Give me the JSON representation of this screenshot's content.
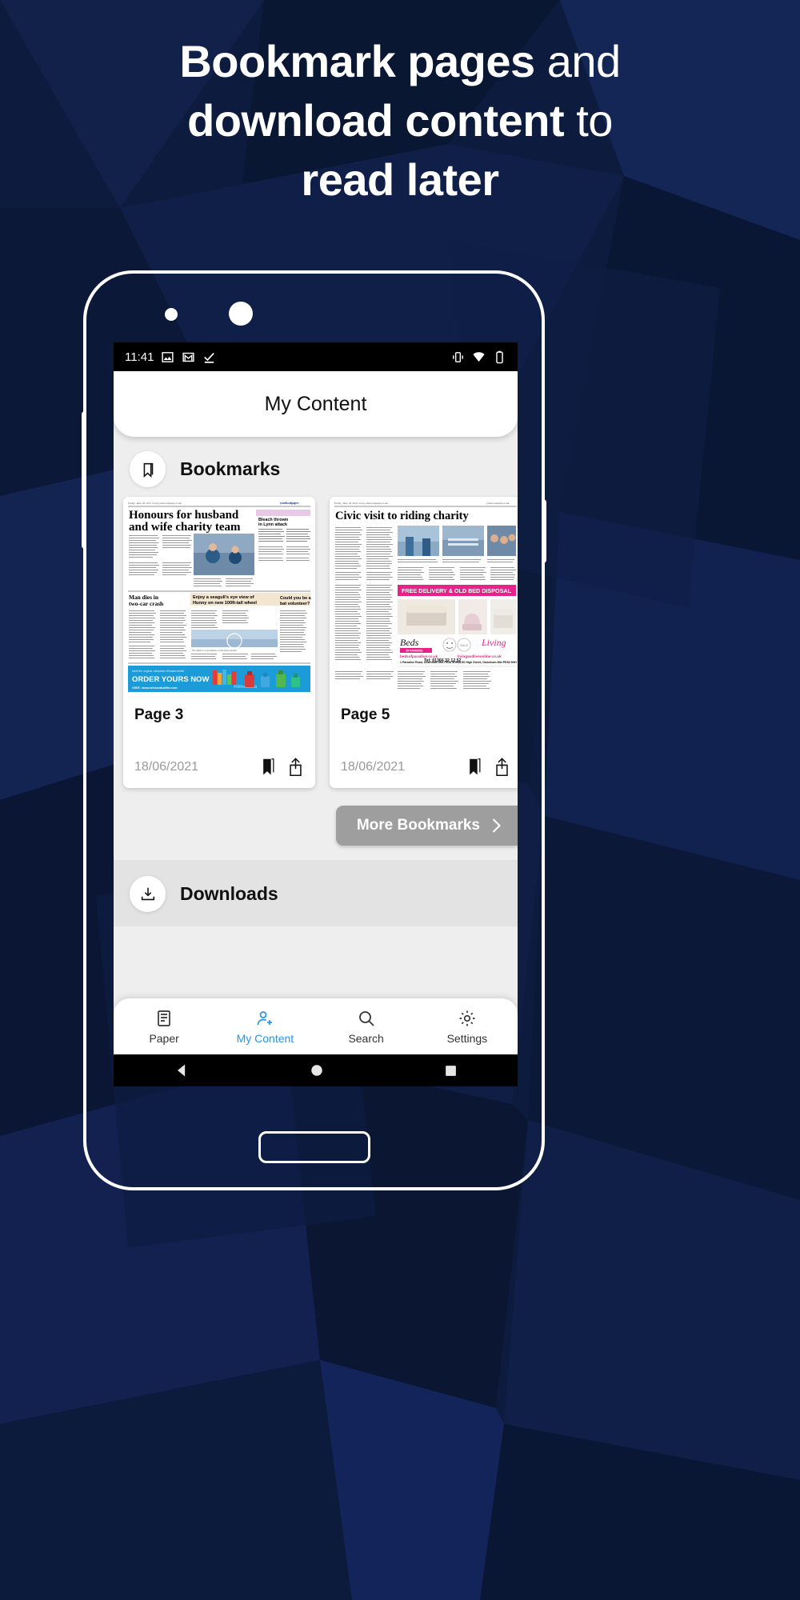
{
  "promo": {
    "headline_line1_bold": "Bookmark pages",
    "headline_line1_light": " and",
    "headline_line2_bold": "download content",
    "headline_line2_light": " to",
    "headline_line3_light": "read later"
  },
  "colors": {
    "background_navy": "#0d1b3e",
    "accent_blue": "#2196f3",
    "more_button_gray": "#9e9e9e",
    "screen_gray": "#eeeeee",
    "date_gray": "#9a9a9a"
  },
  "statusbar": {
    "time": "11:41",
    "left_icons": [
      "image-icon",
      "gmail-icon",
      "checkmark-icon"
    ],
    "right_icons": [
      "vibrate-icon",
      "wifi-icon",
      "battery-icon"
    ]
  },
  "appbar": {
    "title": "My Content"
  },
  "sections": {
    "bookmarks": {
      "title": "Bookmarks",
      "icon": "bookmark-icon"
    },
    "downloads": {
      "title": "Downloads",
      "icon": "download-icon"
    }
  },
  "bookmark_cards": [
    {
      "page_label": "Page 3",
      "date": "18/06/2021",
      "bookmark_icon": "bookmark-filled-icon",
      "share_icon": "share-icon",
      "thumbnail": {
        "masthead_date": "Friday, June 18, 2021   www.yourlocalpaper.co.uk",
        "masthead_brand": "yourlocalpaper",
        "headline": "Honours for husband and wife charity team",
        "sidebar_headline": "Bleach thrown in Lynn attack",
        "secondary_headline_1": "Man dies in two-car crash",
        "secondary_headline_2": "Enjoy a seagull's eye view of Hunny on new 100ft-tall wheel",
        "sidebar_headline_2": "Could you be a bat volunteer?",
        "ad_banner": "ORDER YOURS NOW",
        "ad_sub": "VISIT: www.whosrabottle.com"
      }
    },
    {
      "page_label": "Page 5",
      "date": "18/06/2021",
      "bookmark_icon": "bookmark-filled-icon",
      "share_icon": "share-icon",
      "thumbnail": {
        "masthead_date": "Friday, June 18, 2021   www.yourlocalpaper.co.uk",
        "headline": "Civic visit to riding charity",
        "ad_banner": "FREE DELIVERY & OLD BED DISPOSAL",
        "ad_brand_left": "Beds",
        "ad_brand_left_sub": "OF PARADISE",
        "ad_brand_right": "Living",
        "ad_url_left": "bedsofparadise.co.uk",
        "ad_phone": "Tel: 01366 32 12 52",
        "ad_address_left": "1 Paradise Road, Downham Mkt PE38 9HH",
        "ad_url_right": "livingandliveonline.co.uk",
        "ad_address_right": "48-50 High Street, Downham Mkt PE38 9HH"
      }
    }
  ],
  "more_button": {
    "label": "More Bookmarks",
    "icon": "chevron-right-icon"
  },
  "bottom_nav": [
    {
      "label": "Paper",
      "icon": "paper-icon",
      "active": false
    },
    {
      "label": "My Content",
      "icon": "my-content-icon",
      "active": true
    },
    {
      "label": "Search",
      "icon": "search-icon",
      "active": false
    },
    {
      "label": "Settings",
      "icon": "gear-icon",
      "active": false
    }
  ],
  "android_nav": [
    "back-icon",
    "home-icon",
    "recents-icon"
  ]
}
